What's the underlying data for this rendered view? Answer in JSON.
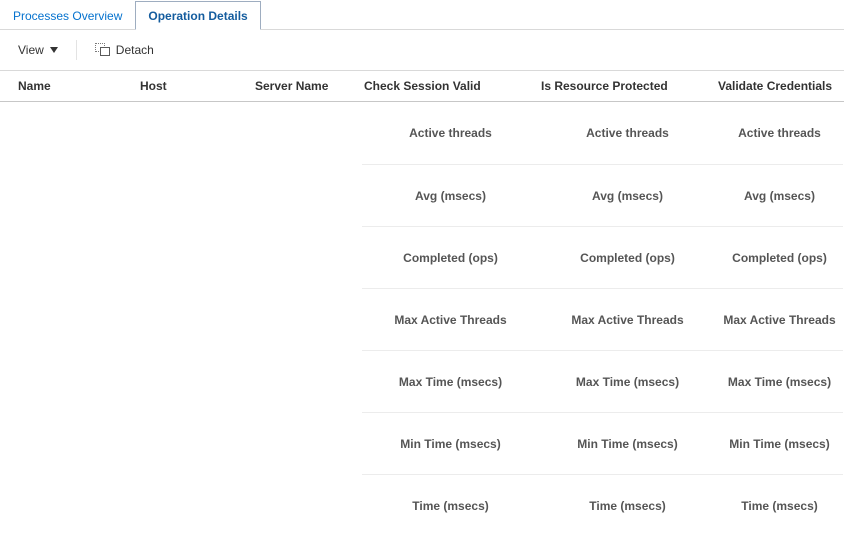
{
  "tabs": {
    "processes_overview": "Processes Overview",
    "operation_details": "Operation Details"
  },
  "toolbar": {
    "view_label": "View",
    "detach_label": "Detach"
  },
  "headers": {
    "name": "Name",
    "host": "Host",
    "server": "Server Name",
    "check_session": "Check Session Valid",
    "is_resource": "Is Resource Protected",
    "validate": "Validate Credentials"
  },
  "metrics": [
    "Active threads",
    "Avg (msecs)",
    "Completed (ops)",
    "Max Active Threads",
    "Max Time (msecs)",
    "Min Time (msecs)",
    "Time (msecs)"
  ]
}
